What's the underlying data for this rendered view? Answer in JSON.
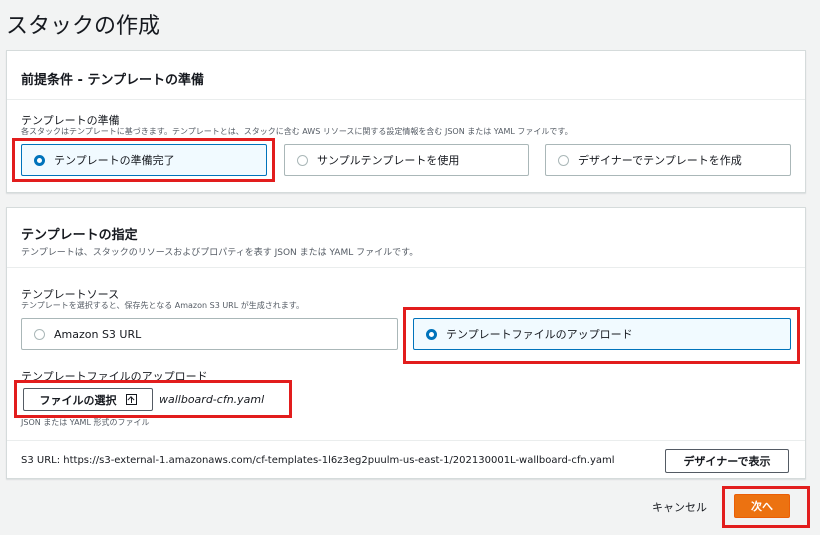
{
  "page": {
    "title": "スタックの作成"
  },
  "prerequisite": {
    "title": "前提条件 - テンプレートの準備",
    "field_label": "テンプレートの準備",
    "field_description": "各スタックはテンプレートに基づきます。テンプレートとは、スタックに含む AWS リソースに関する設定情報を含む JSON または YAML ファイルです。",
    "options": [
      {
        "label": "テンプレートの準備完了",
        "selected": true
      },
      {
        "label": "サンプルテンプレートを使用",
        "selected": false
      },
      {
        "label": "デザイナーでテンプレートを作成",
        "selected": false
      }
    ]
  },
  "specify": {
    "title": "テンプレートの指定",
    "description": "テンプレートは、スタックのリソースおよびプロパティを表す JSON または YAML ファイルです。",
    "source_label": "テンプレートソース",
    "source_description": "テンプレートを選択すると、保存先となる Amazon S3 URL が生成されます。",
    "source_options": [
      {
        "label": "Amazon S3 URL",
        "selected": false
      },
      {
        "label": "テンプレートファイルのアップロード",
        "selected": true
      }
    ],
    "upload_label": "テンプレートファイルのアップロード",
    "choose_file_label": "ファイルの選択",
    "file_name": "wallboard-cfn.yaml",
    "file_hint": "JSON または YAML 形式のファイル",
    "s3_url": "S3 URL:  https://s3-external-1.amazonaws.com/cf-templates-1l6z3eg2puulm-us-east-1/202130001L-wallboard-cfn.yaml",
    "designer_button": "デザイナーで表示"
  },
  "footer": {
    "cancel_label": "キャンセル",
    "next_label": "次へ"
  },
  "colors": {
    "accent": "#0073bb",
    "primary_button": "#ec7211",
    "highlight": "#e21d1d"
  }
}
